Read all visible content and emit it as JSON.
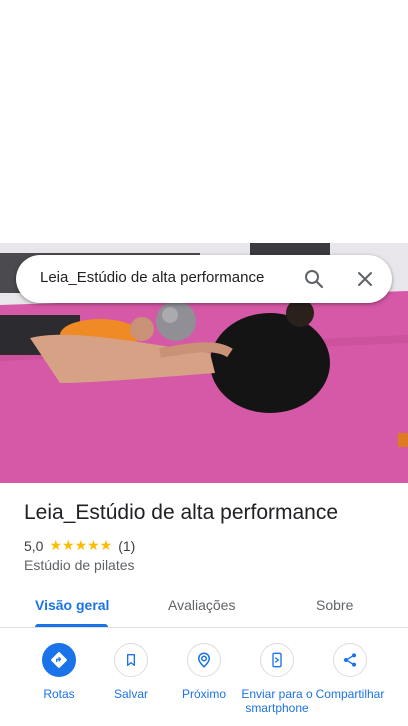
{
  "search": {
    "query": "Leia_Estúdio de alta performance"
  },
  "place": {
    "name": "Leia_Estúdio de alta performance",
    "rating_value": "5,0",
    "stars": "★★★★★",
    "review_count": "(1)",
    "category": "Estúdio de pilates"
  },
  "tabs": [
    {
      "label": "Visão geral",
      "active": true
    },
    {
      "label": "Avaliações",
      "active": false
    },
    {
      "label": "Sobre",
      "active": false
    }
  ],
  "actions": [
    {
      "label": "Rotas",
      "icon": "directions-icon"
    },
    {
      "label": "Salvar",
      "icon": "bookmark-icon"
    },
    {
      "label": "Próximo",
      "icon": "nearby-icon"
    },
    {
      "label": "Enviar para o smartphone",
      "icon": "send-to-phone-icon"
    },
    {
      "label": "Compartilhar",
      "icon": "share-icon"
    }
  ],
  "colors": {
    "accent": "#1a73e8",
    "star": "#fbbc04"
  }
}
